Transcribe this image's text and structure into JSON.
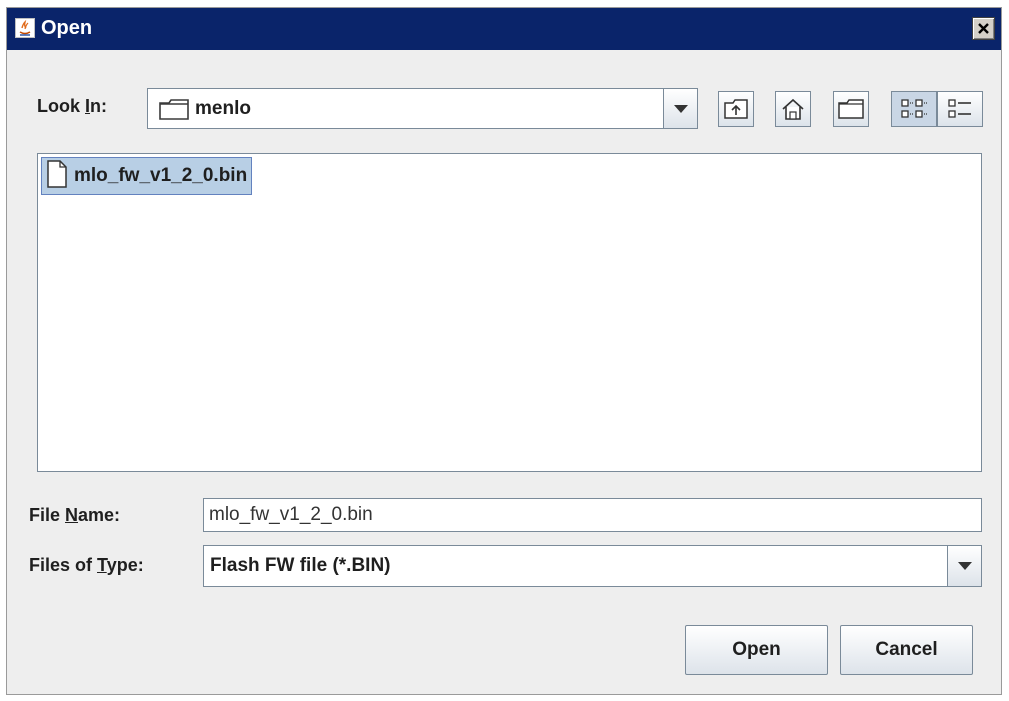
{
  "title": "Open",
  "look_in": {
    "label_pre": "Look ",
    "label_mnemonic": "I",
    "label_post": "n:",
    "value": "menlo"
  },
  "toolbar": {
    "icons": [
      "up-one-level-icon",
      "home-icon",
      "new-folder-icon",
      "list-view-icon",
      "details-view-icon"
    ]
  },
  "files": [
    {
      "name": "mlo_fw_v1_2_0.bin",
      "selected": true
    }
  ],
  "file_name": {
    "label_pre": "File ",
    "label_mnemonic": "N",
    "label_post": "ame:",
    "value": "mlo_fw_v1_2_0.bin"
  },
  "files_of_type": {
    "label_pre": "Files of ",
    "label_mnemonic": "T",
    "label_post": "ype:",
    "value": "Flash FW file (*.BIN)"
  },
  "buttons": {
    "open": "Open",
    "cancel": "Cancel"
  },
  "colors": {
    "titlebar": "#0a246a",
    "dialog_bg": "#eeeeee",
    "selection": "#b8cfe5"
  }
}
